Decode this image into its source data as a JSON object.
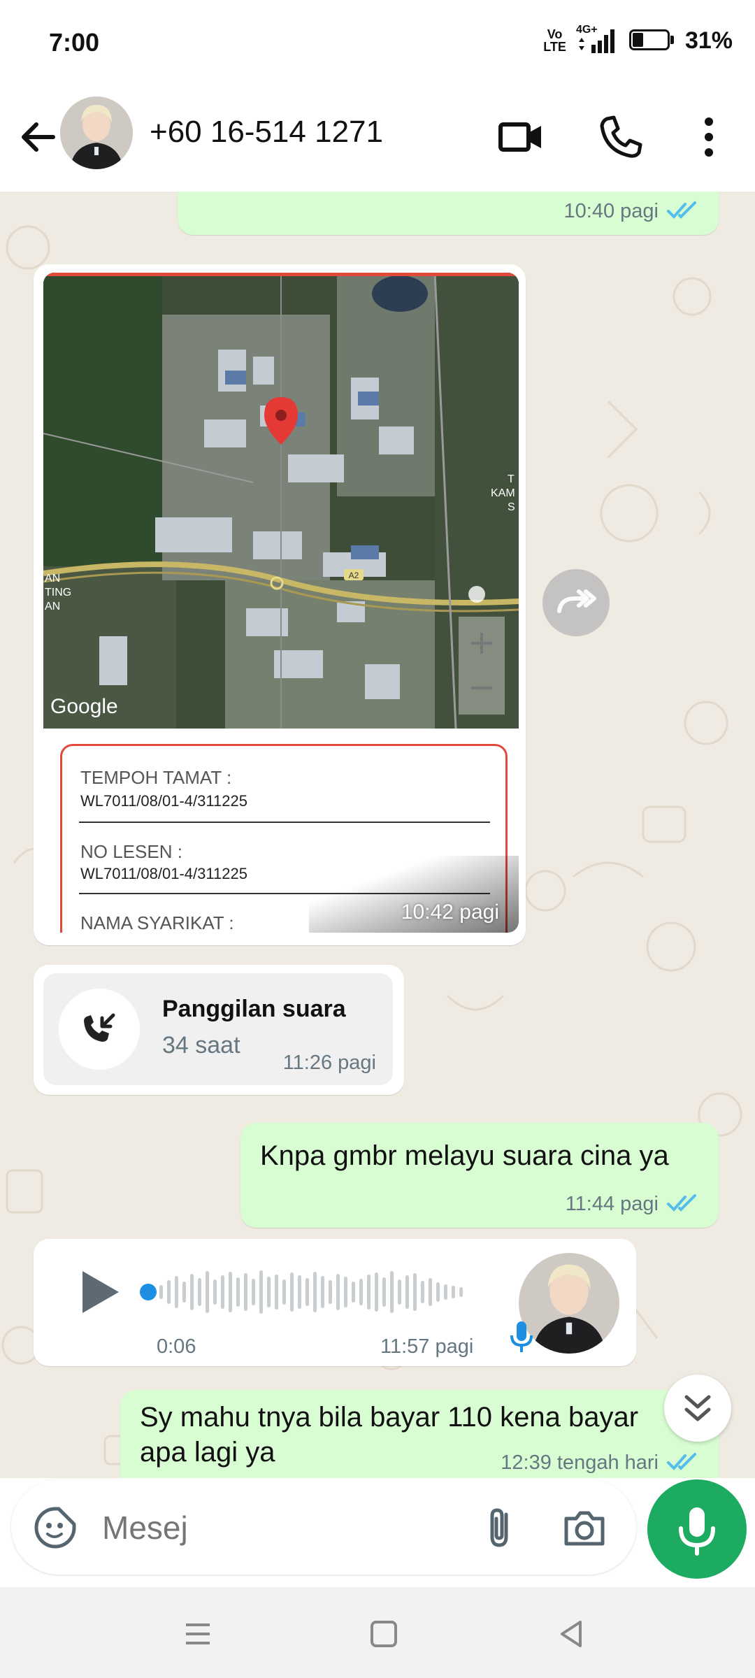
{
  "status_bar": {
    "time": "7:00",
    "volte": "Vo\nLTE",
    "network": "4G+",
    "battery": "31%",
    "battery_level": 0.31
  },
  "header": {
    "contact_name": "+60 16-514 1271",
    "icons": [
      "back-arrow-icon",
      "video-call-icon",
      "phone-call-icon",
      "more-options-icon"
    ]
  },
  "messages": [
    {
      "type": "outgoing-text",
      "time": "10:40 pagi",
      "status": "read"
    },
    {
      "type": "incoming-image",
      "time": "10:42 pagi",
      "map": {
        "google_label": "Google",
        "road_label": "A2",
        "edge_labels": [
          "AN",
          "TING",
          "AN",
          "T",
          "KAM",
          "S"
        ]
      },
      "document": [
        {
          "label": "TEMPOH TAMAT :",
          "value": "WL7011/08/01-4/311225"
        },
        {
          "label": "NO LESEN :",
          "value": "WL7011/08/01-4/311225"
        },
        {
          "label": "NAMA SYARIKAT :",
          "value": ""
        }
      ]
    },
    {
      "type": "incoming-call",
      "title": "Panggilan suara",
      "duration": "34 saat",
      "time": "11:26 pagi"
    },
    {
      "type": "outgoing-text",
      "text": "Knpa gmbr melayu suara cina ya",
      "time": "11:44 pagi",
      "status": "read"
    },
    {
      "type": "incoming-voice",
      "duration": "0:06",
      "time": "11:57 pagi",
      "progress": 0.0
    },
    {
      "type": "outgoing-text",
      "text_line1": "Sy mahu tnya bila bayar 110 kena bayar",
      "text_line2": "apa lagi ya",
      "time": "12:39 tengah hari",
      "status": "read"
    }
  ],
  "composer": {
    "placeholder": "Mesej",
    "icons": [
      "sticker-icon",
      "attach-icon",
      "camera-icon",
      "microphone-icon"
    ]
  },
  "colors": {
    "outgoing_bubble": "#d9fdd3",
    "incoming_bubble": "#ffffff",
    "chat_background": "#efeae2",
    "accent_green": "#1daa61",
    "read_ticks": "#53bdeb"
  }
}
